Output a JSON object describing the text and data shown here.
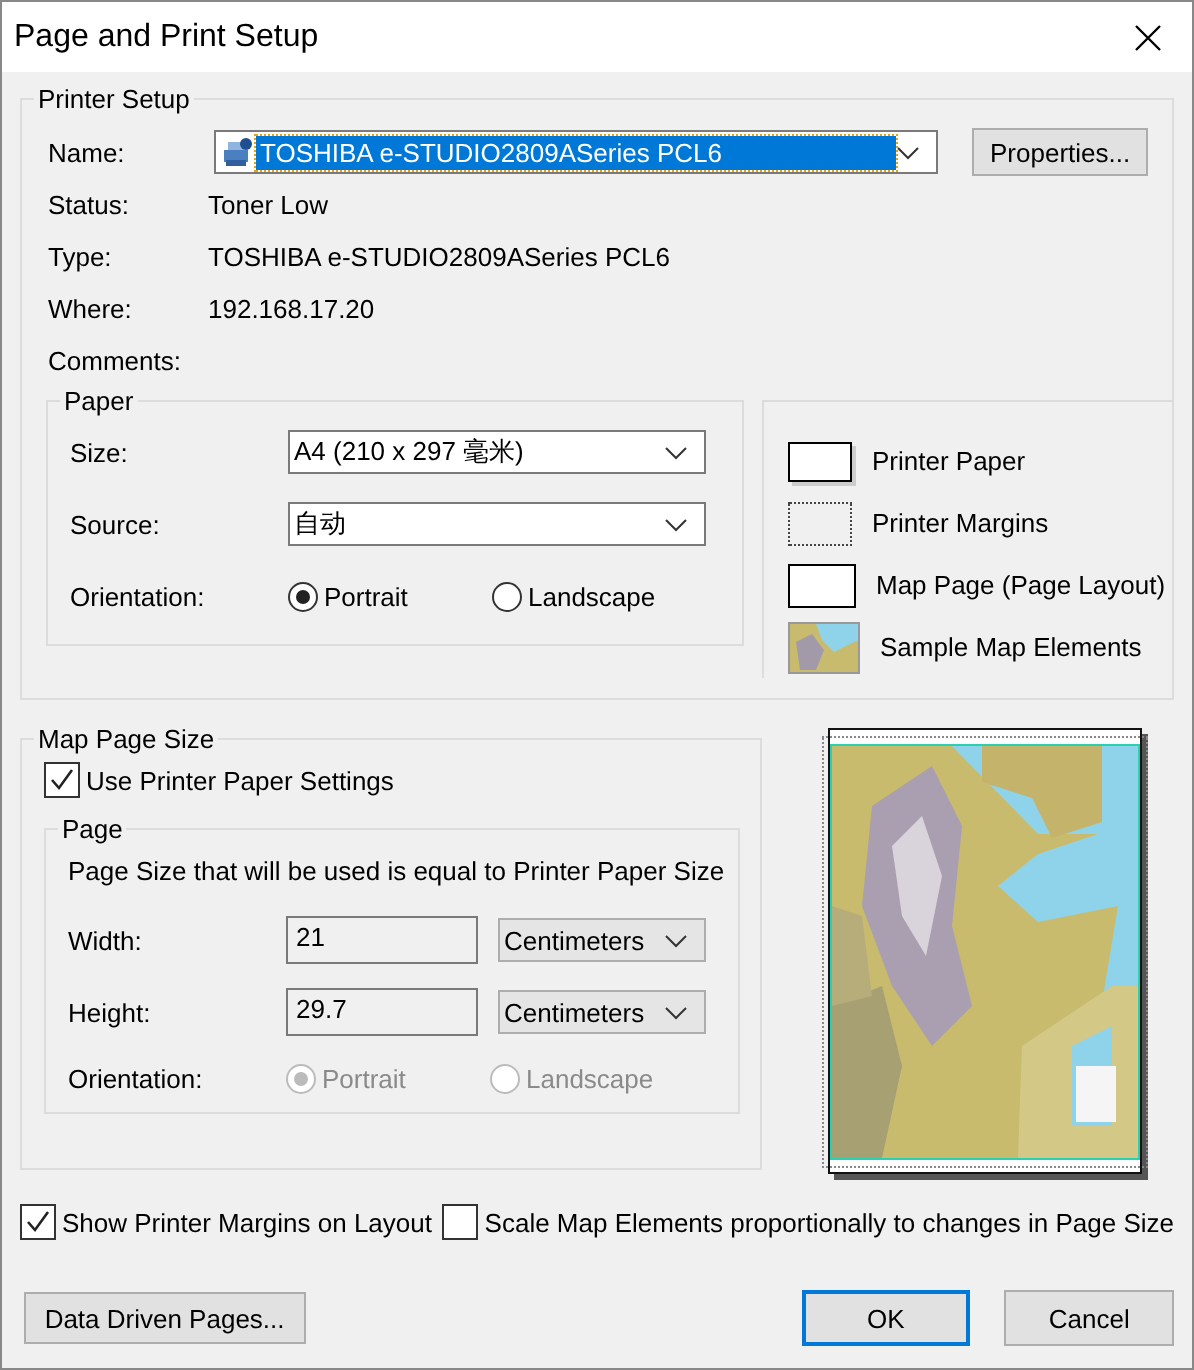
{
  "window": {
    "title": "Page and Print Setup"
  },
  "printer_setup": {
    "title": "Printer Setup",
    "name_label": "Name:",
    "name_value": "TOSHIBA e-STUDIO2809ASeries PCL6",
    "name_highlighted": true,
    "properties_button": "Properties...",
    "info": [
      {
        "label": "Status:",
        "value": "Toner Low"
      },
      {
        "label": "Type:",
        "value": "TOSHIBA e-STUDIO2809ASeries PCL6"
      },
      {
        "label": "Where:",
        "value": "192.168.17.20"
      },
      {
        "label": "Comments:"
      }
    ]
  },
  "paper": {
    "title": "Paper",
    "size_label": "Size:",
    "size": "A4 (210 x 297 毫米)",
    "source_label": "Source:",
    "source": "自动",
    "orientation_label": "Orientation:",
    "orientations": [
      {
        "label": "Portrait",
        "selected": true
      },
      {
        "label": "Landscape",
        "selected": false
      }
    ]
  },
  "legend": [
    {
      "kind": "paper",
      "label": "Printer Paper"
    },
    {
      "kind": "margins",
      "label": "Printer Margins"
    },
    {
      "kind": "page",
      "label": "Map Page (Page Layout)"
    },
    {
      "kind": "sample",
      "label": "Sample Map Elements"
    }
  ],
  "map_page_size": {
    "title": "Map Page Size",
    "use_printer_paper": {
      "label": "Use Printer Paper Settings",
      "checked": true
    },
    "page": {
      "title": "Page",
      "note": "Page Size that will be used is equal to Printer Paper Size",
      "fields": [
        {
          "label": "Width:",
          "value": "21",
          "unit": "Centimeters"
        },
        {
          "label": "Height:",
          "value": "29.7",
          "unit": "Centimeters"
        }
      ],
      "orientation_label": "Orientation:",
      "orientation_disabled": true,
      "orientations": [
        {
          "label": "Portrait",
          "selected": true
        },
        {
          "label": "Landscape",
          "selected": false
        }
      ]
    }
  },
  "options": [
    {
      "label": "Show Printer Margins on Layout",
      "checked": true
    },
    {
      "label": "Scale Map Elements proportionally to changes in Page Size",
      "checked": false
    }
  ],
  "buttons": [
    {
      "label": "Data Driven Pages...",
      "default": false
    },
    {
      "label": "OK",
      "default": true
    },
    {
      "label": "Cancel",
      "default": false
    }
  ]
}
